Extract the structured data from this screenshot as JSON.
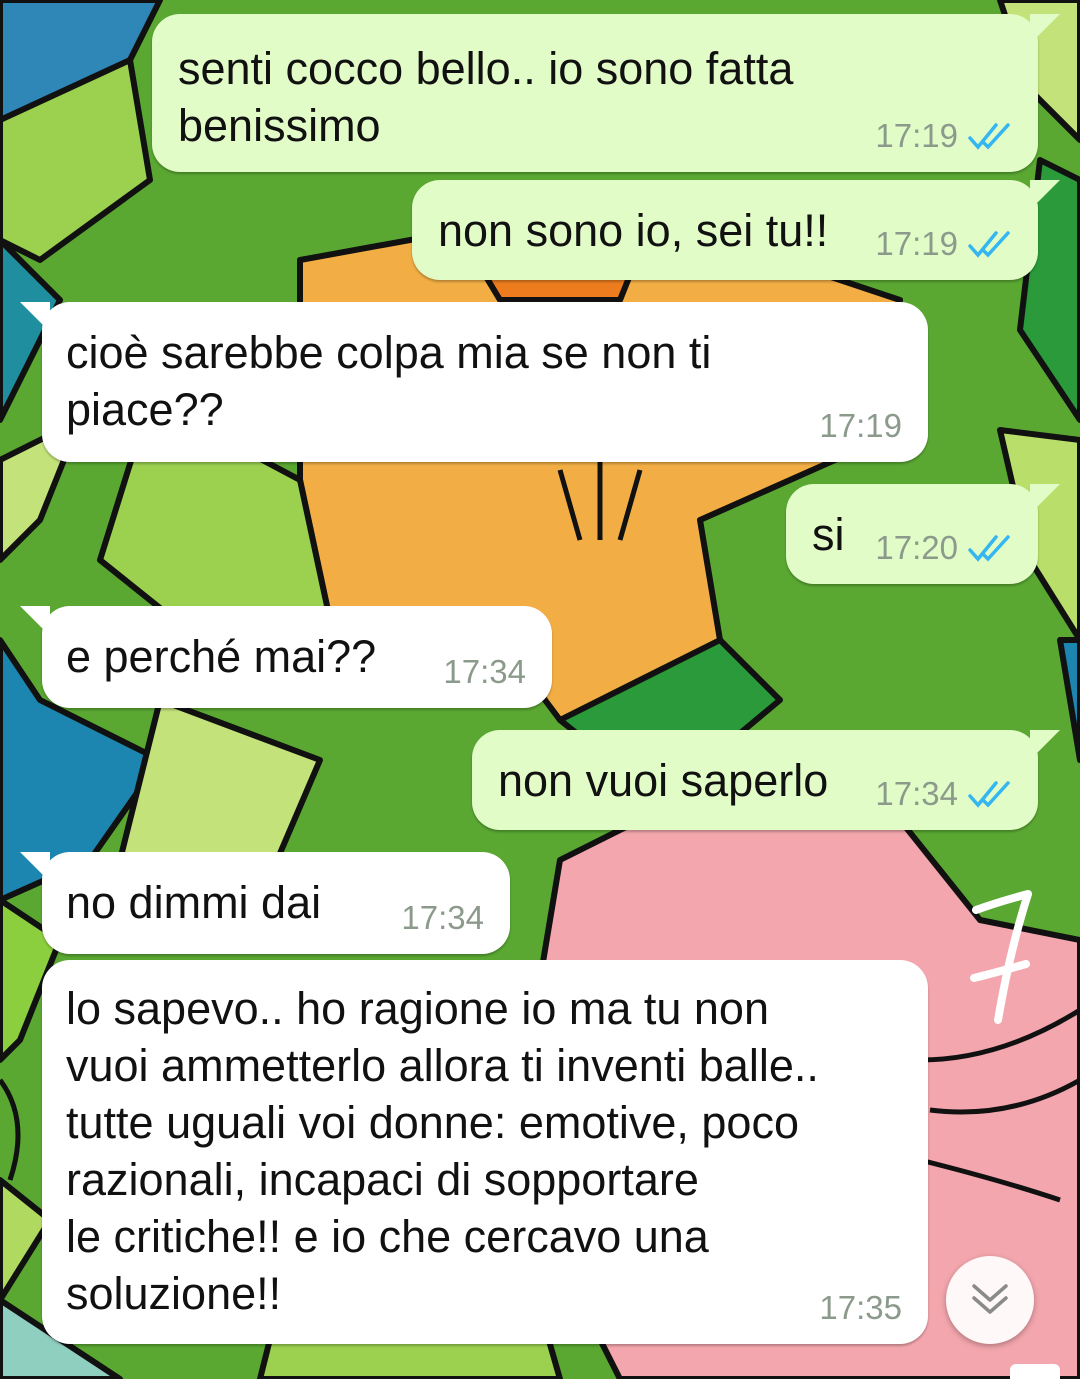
{
  "theme": {
    "outgoing_bubble": "#e2fcc8",
    "incoming_bubble": "#ffffff",
    "timestamp_color": "#8c9a8c",
    "read_tick_color": "#34b7f1"
  },
  "messages": [
    {
      "direction": "out",
      "text": "senti cocco bello.. io sono fatta\nbenissimo",
      "time": "17:19",
      "status": "read-double-tick-icon"
    },
    {
      "direction": "out",
      "text": "non sono io, sei tu!!",
      "time": "17:19",
      "status": "read-double-tick-icon"
    },
    {
      "direction": "in",
      "text": "cioè sarebbe colpa mia se non ti\npiace??",
      "time": "17:19"
    },
    {
      "direction": "out",
      "text": "si",
      "time": "17:20",
      "status": "read-double-tick-icon"
    },
    {
      "direction": "in",
      "text": "e perché mai??",
      "time": "17:34"
    },
    {
      "direction": "out",
      "text": "non vuoi saperlo",
      "time": "17:34",
      "status": "read-double-tick-icon"
    },
    {
      "direction": "in",
      "text": "no dimmi dai",
      "time": "17:34"
    },
    {
      "direction": "in",
      "text": "lo sapevo.. ho ragione io ma tu non\nvuoi ammetterlo allora ti inventi balle..\ntutte uguali voi donne: emotive, poco\nrazionali, incapaci di sopportare\nle critiche!! e io che cercavo una\nsoluzione!!",
      "time": "17:35"
    }
  ],
  "controls": {
    "scroll_to_bottom_icon": "double-chevron-down-icon"
  }
}
